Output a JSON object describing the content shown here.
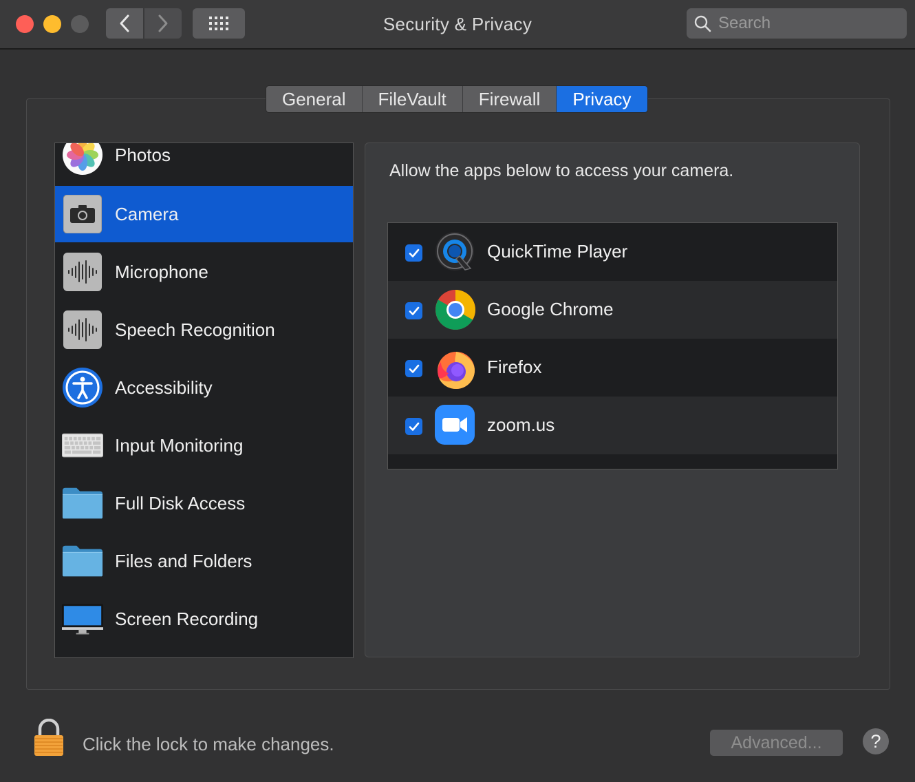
{
  "window": {
    "title": "Security & Privacy"
  },
  "search": {
    "placeholder": "Search"
  },
  "tabs": [
    {
      "label": "General"
    },
    {
      "label": "FileVault"
    },
    {
      "label": "Firewall"
    },
    {
      "label": "Privacy",
      "active": true
    }
  ],
  "sidebar": {
    "items": [
      {
        "label": "Photos",
        "icon": "photos-icon"
      },
      {
        "label": "Camera",
        "icon": "camera-icon",
        "selected": true
      },
      {
        "label": "Microphone",
        "icon": "microphone-icon"
      },
      {
        "label": "Speech Recognition",
        "icon": "speech-recognition-icon"
      },
      {
        "label": "Accessibility",
        "icon": "accessibility-icon"
      },
      {
        "label": "Input Monitoring",
        "icon": "keyboard-icon"
      },
      {
        "label": "Full Disk Access",
        "icon": "folder-icon"
      },
      {
        "label": "Files and Folders",
        "icon": "folder-icon"
      },
      {
        "label": "Screen Recording",
        "icon": "display-icon"
      }
    ]
  },
  "main": {
    "prompt": "Allow the apps below to access your camera.",
    "apps": [
      {
        "label": "QuickTime Player",
        "checked": true,
        "icon": "quicktime-icon"
      },
      {
        "label": "Google Chrome",
        "checked": true,
        "icon": "chrome-icon"
      },
      {
        "label": "Firefox",
        "checked": true,
        "icon": "firefox-icon"
      },
      {
        "label": "zoom.us",
        "checked": true,
        "icon": "zoom-icon"
      }
    ]
  },
  "footer": {
    "lock_text": "Click the lock to make changes.",
    "advanced_label": "Advanced...",
    "help_label": "?"
  },
  "colors": {
    "accent": "#1b6fe2",
    "selection": "#0f5bd0"
  }
}
